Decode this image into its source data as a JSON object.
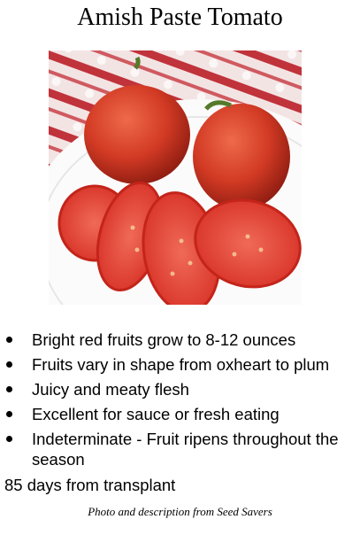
{
  "title": "Amish Paste Tomato",
  "photo": {
    "subject": "tomato-photo"
  },
  "features": [
    "Bright red fruits grow to 8-12 ounces",
    "Fruits vary in shape from oxheart to plum",
    "Juicy and meaty flesh",
    "Excellent for sauce or fresh eating",
    "Indeterminate - Fruit ripens throughout the season"
  ],
  "maturity": "85 days from transplant",
  "credit": "Photo and description from  Seed Savers"
}
